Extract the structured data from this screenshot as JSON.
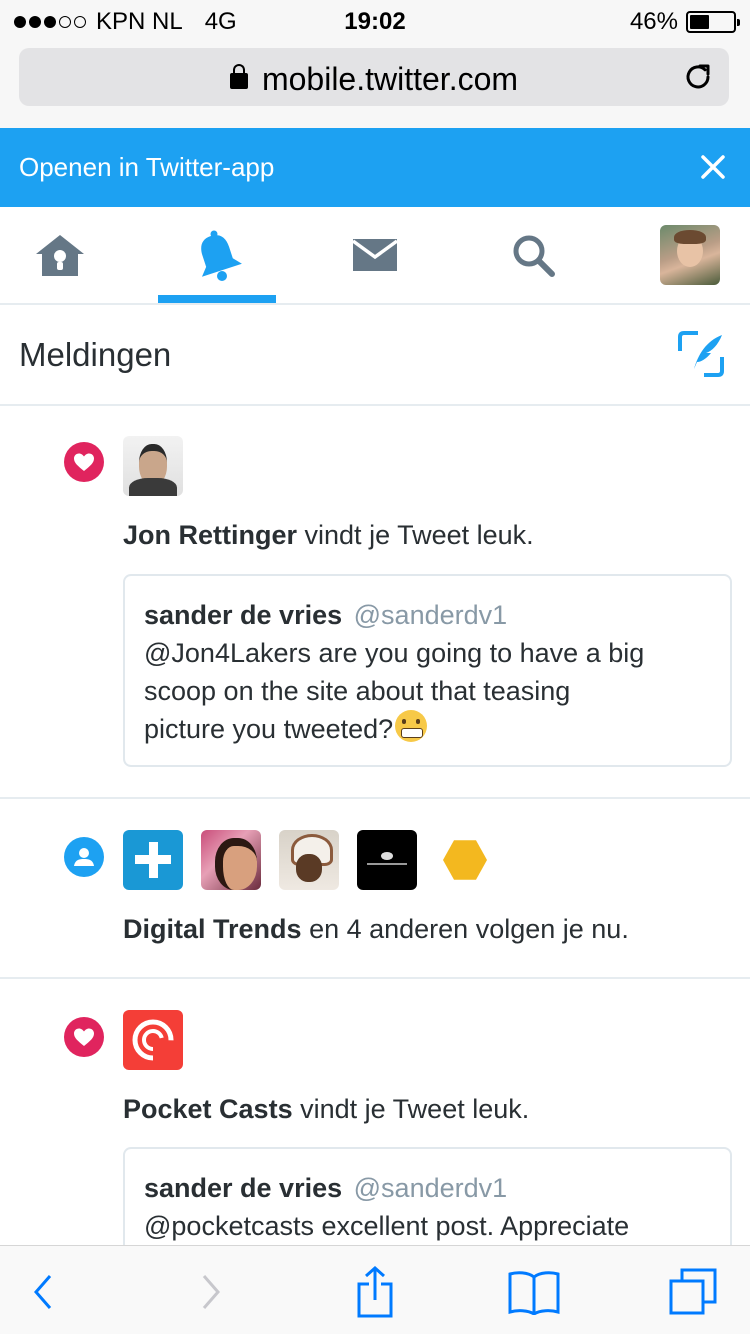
{
  "status_bar": {
    "carrier": "KPN NL",
    "network": "4G",
    "time": "19:02",
    "battery_percent": "46%",
    "battery_level": 0.46,
    "signal_bars_filled": 3,
    "signal_bars_total": 5
  },
  "browser": {
    "url": "mobile.twitter.com"
  },
  "app_banner": {
    "label": "Openen in Twitter-app"
  },
  "nav": {
    "items": [
      "home",
      "notifications",
      "messages",
      "search",
      "profile"
    ],
    "active": "notifications"
  },
  "page": {
    "title": "Meldingen"
  },
  "notifications": [
    {
      "type": "like",
      "actor": "Jon Rettinger",
      "action": "vindt je Tweet leuk.",
      "tweet": {
        "name": "sander de vries",
        "handle": "@sanderdv1",
        "lines": [
          "@Jon4Lakers are you going to have a big",
          "scoop on the site about that teasing",
          "picture you tweeted?"
        ]
      }
    },
    {
      "type": "follow",
      "actor": "Digital Trends",
      "action": "en 4 anderen volgen je nu."
    },
    {
      "type": "like",
      "actor": "Pocket Casts",
      "action": "vindt je Tweet leuk.",
      "tweet": {
        "name": "sander de vries",
        "handle": "@sanderdv1",
        "lines": [
          "@pocketcasts excellent post. Appreciate"
        ]
      }
    }
  ],
  "colors": {
    "twitter_blue": "#1da1f2",
    "like_red": "#e0245e",
    "icon_gray": "#657786",
    "divider": "#e6ecf0",
    "ios_blue": "#007aff"
  }
}
